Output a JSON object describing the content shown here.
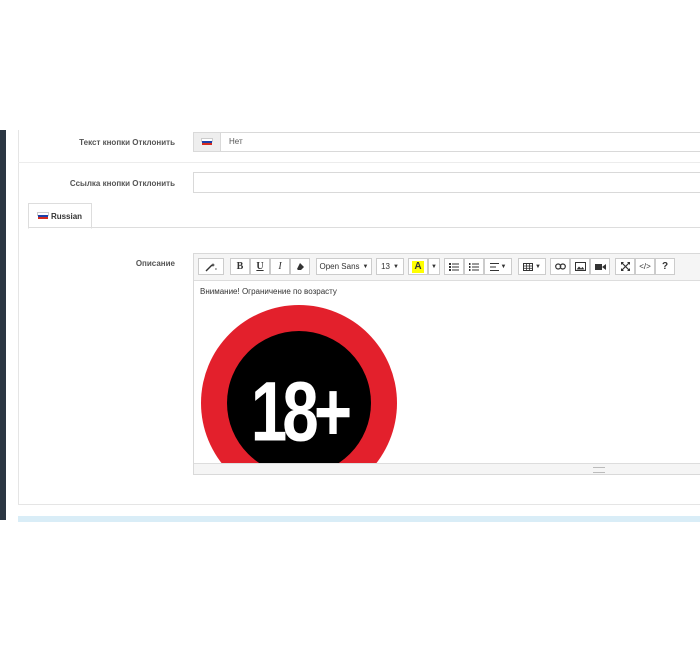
{
  "form": {
    "decline_text_label": "Текст кнопки Отклонить",
    "decline_text_value": "Нет",
    "decline_link_label": "Ссылка кнопки Отклонить",
    "decline_link_value": "",
    "description_label": "Описание"
  },
  "language_tab": {
    "label": "Russian",
    "flag_icon": "russia-flag-icon"
  },
  "editor": {
    "toolbar": {
      "style_icon": "magic-wand-icon",
      "bold": "B",
      "underline": "U",
      "italic": "I",
      "eraser_icon": "eraser-icon",
      "font_family": "Open Sans",
      "font_size": "13",
      "color_letter": "A",
      "ul_icon": "unordered-list-icon",
      "ol_icon": "ordered-list-icon",
      "align_icon": "align-icon",
      "table_icon": "table-icon",
      "link_icon": "link-icon",
      "image_icon": "image-icon",
      "video_icon": "video-icon",
      "fullscreen_icon": "fullscreen-icon",
      "code_label": "</>",
      "help_label": "?"
    },
    "content_text": "Внимание! Ограничение по возрасту",
    "image_label": "18+"
  },
  "colors": {
    "sidebar": "#2b3643",
    "badge_red": "#e3202c",
    "badge_black": "#000000",
    "highlight_yellow": "#ffff00",
    "info_bar": "#d9edf7"
  }
}
